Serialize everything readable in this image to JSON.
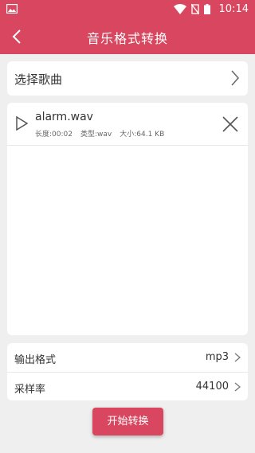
{
  "colors": {
    "accent": "#d8475f",
    "background": "#efefef",
    "card": "#ffffff"
  },
  "status_bar": {
    "time": "10:14",
    "icons": [
      "image-icon",
      "wifi-icon",
      "no-sim-icon",
      "battery-icon"
    ]
  },
  "app_bar": {
    "title": "音乐格式转换",
    "back_icon": "chevron-left-icon"
  },
  "select_song": {
    "label": "选择歌曲"
  },
  "file": {
    "name": "alarm.wav",
    "duration": "长度:00:02",
    "type": "类型:wav",
    "size": "大小:64.1 KB"
  },
  "options": {
    "output_format": {
      "label": "输出格式",
      "value": "mp3"
    },
    "sample_rate": {
      "label": "采样率",
      "value": "44100"
    }
  },
  "start_button": {
    "label": "开始转换"
  }
}
